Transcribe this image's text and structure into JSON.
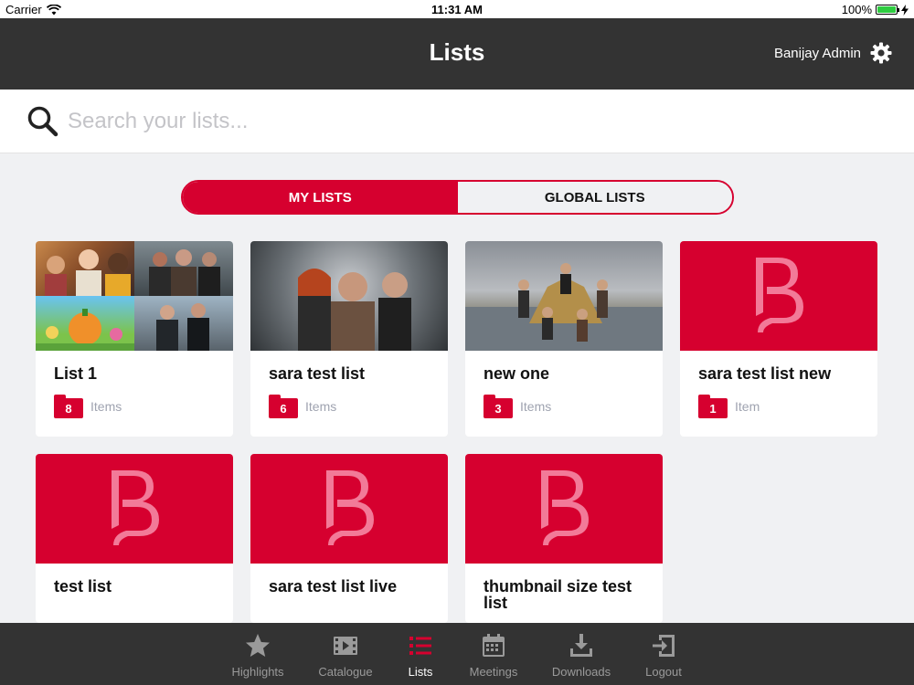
{
  "status": {
    "carrier": "Carrier",
    "time": "11:31 AM",
    "battery": "100%"
  },
  "header": {
    "title": "Lists",
    "user": "Banijay Admin"
  },
  "search": {
    "placeholder": "Search your lists..."
  },
  "segments": [
    {
      "label": "MY LISTS"
    },
    {
      "label": "GLOBAL LISTS"
    }
  ],
  "lists": [
    {
      "name": "List 1",
      "count": "8",
      "unit": "Items"
    },
    {
      "name": "sara test list",
      "count": "6",
      "unit": "Items"
    },
    {
      "name": "new one",
      "count": "3",
      "unit": "Items"
    },
    {
      "name": "sara test list new",
      "count": "1",
      "unit": "Item"
    },
    {
      "name": "test list"
    },
    {
      "name": "sara test list live"
    },
    {
      "name": "thumbnail size test list"
    }
  ],
  "tabs": [
    {
      "label": "Highlights",
      "icon": "star-icon"
    },
    {
      "label": "Catalogue",
      "icon": "film-icon"
    },
    {
      "label": "Lists",
      "icon": "list-icon"
    },
    {
      "label": "Meetings",
      "icon": "calendar-icon"
    },
    {
      "label": "Downloads",
      "icon": "download-icon"
    },
    {
      "label": "Logout",
      "icon": "logout-icon"
    }
  ],
  "colors": {
    "accent": "#d6002f",
    "header": "#333333",
    "background": "#f0f1f3"
  }
}
